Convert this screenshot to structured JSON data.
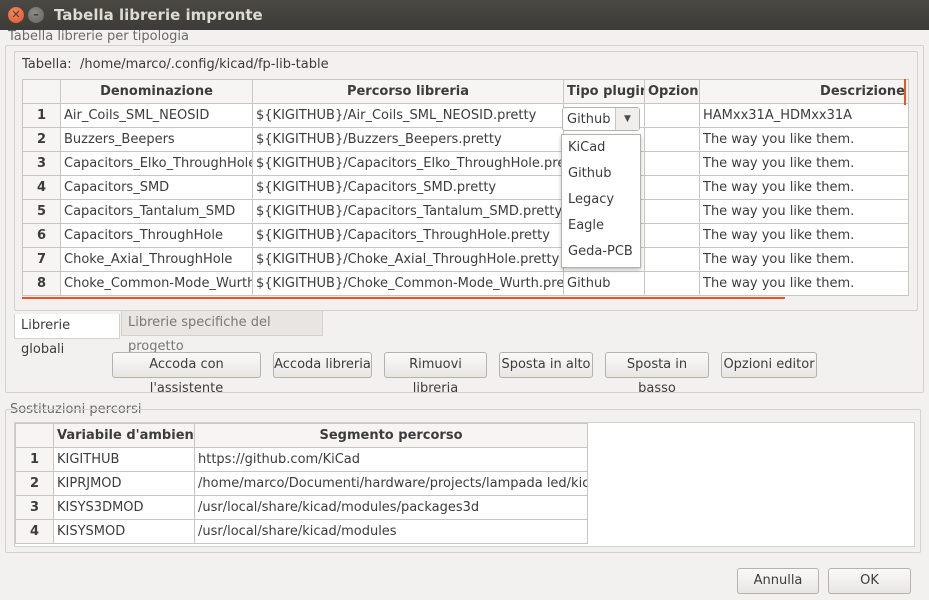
{
  "window": {
    "title": "Tabella librerie impronte"
  },
  "library_group": {
    "label": "Tabella librerie per tipologia"
  },
  "library_path": {
    "label": "Tabella:",
    "value": "/home/marco/.config/kicad/fp-lib-table"
  },
  "library_table": {
    "columns": [
      "Denominazione",
      "Percorso libreria",
      "Tipo plugin",
      "Opzioni",
      "Descrizione"
    ],
    "rows": [
      {
        "num": "1",
        "name": "Air_Coils_SML_NEOSID",
        "path": "${KIGITHUB}/Air_Coils_SML_NEOSID.pretty",
        "plugin": "",
        "options": "",
        "desc": "HAMxx31A_HDMxx31A"
      },
      {
        "num": "2",
        "name": "Buzzers_Beepers",
        "path": "${KIGITHUB}/Buzzers_Beepers.pretty",
        "plugin": "",
        "options": "",
        "desc": "The way you like them."
      },
      {
        "num": "3",
        "name": "Capacitors_Elko_ThroughHole",
        "path": "${KIGITHUB}/Capacitors_Elko_ThroughHole.pretty",
        "plugin": "",
        "options": "",
        "desc": "The way you like them."
      },
      {
        "num": "4",
        "name": "Capacitors_SMD",
        "path": "${KIGITHUB}/Capacitors_SMD.pretty",
        "plugin": "",
        "options": "",
        "desc": "The way you like them."
      },
      {
        "num": "5",
        "name": "Capacitors_Tantalum_SMD",
        "path": "${KIGITHUB}/Capacitors_Tantalum_SMD.pretty",
        "plugin": "",
        "options": "",
        "desc": "The way you like them."
      },
      {
        "num": "6",
        "name": "Capacitors_ThroughHole",
        "path": "${KIGITHUB}/Capacitors_ThroughHole.pretty",
        "plugin": "",
        "options": "",
        "desc": "The way you like them."
      },
      {
        "num": "7",
        "name": "Choke_Axial_ThroughHole",
        "path": "${KIGITHUB}/Choke_Axial_ThroughHole.pretty",
        "plugin": "",
        "options": "",
        "desc": "The way you like them."
      },
      {
        "num": "8",
        "name": "Choke_Common-Mode_Wurth",
        "path": "${KIGITHUB}/Choke_Common-Mode_Wurth.pretty",
        "plugin": "Github",
        "options": "",
        "desc": "The way you like them."
      }
    ]
  },
  "plugin_combo": {
    "value": "Github",
    "options": [
      "KiCad",
      "Github",
      "Legacy",
      "Eagle",
      "Geda-PCB"
    ]
  },
  "tabs": [
    "Librerie globali",
    "Librerie specifiche del progetto"
  ],
  "buttons": {
    "append_wizard": "Accoda con l'assistente",
    "append_library": "Accoda libreria",
    "remove_library": "Rimuovi libreria",
    "move_up": "Sposta in alto",
    "move_down": "Sposta in basso",
    "editor_options": "Opzioni editor"
  },
  "env_group": {
    "label": "Sostituzioni percorsi"
  },
  "env_table": {
    "columns": [
      "Variabile d'ambiente",
      "Segmento percorso"
    ],
    "rows": [
      {
        "num": "1",
        "var": "KIGITHUB",
        "path": "https://github.com/KiCad"
      },
      {
        "num": "2",
        "var": "KIPRJMOD",
        "path": "/home/marco/Documenti/hardware/projects/lampada led/kicad"
      },
      {
        "num": "3",
        "var": "KISYS3DMOD",
        "path": "/usr/local/share/kicad/modules/packages3d"
      },
      {
        "num": "4",
        "var": "KISYSMOD",
        "path": "/usr/local/share/kicad/modules"
      }
    ]
  },
  "dialog_buttons": {
    "cancel": "Annulla",
    "ok": "OK"
  },
  "colors": {
    "accent": "#e95420",
    "titlebar": "#3c3b37"
  }
}
